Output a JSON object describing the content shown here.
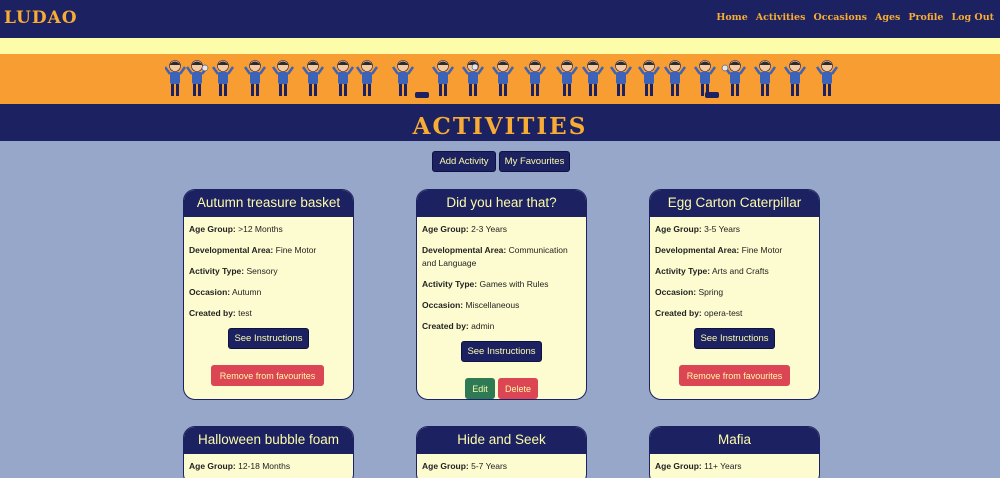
{
  "nav": {
    "brand": "LUDAO",
    "links": [
      "Home",
      "Activities",
      "Occasions",
      "Ages",
      "Profile",
      "Log Out"
    ]
  },
  "page": {
    "title": "ACTIVITIES"
  },
  "actions": {
    "add_activity": "Add Activity",
    "my_favourites": "My Favourites"
  },
  "labels": {
    "age_group": "Age Group:",
    "developmental_area": "Developmental Area:",
    "activity_type": "Activity Type:",
    "occasion": "Occasion:",
    "created_by": "Created by:",
    "see_instructions": "See Instructions",
    "remove_favourites": "Remove from favourites",
    "edit": "Edit",
    "delete": "Delete"
  },
  "cards": [
    {
      "title": "Autumn treasure basket",
      "age_group": ">12 Months",
      "developmental_area": "Fine Motor",
      "activity_type": "Sensory",
      "occasion": "Autumn",
      "created_by": "test"
    },
    {
      "title": "Did you hear that?",
      "age_group": "2-3 Years",
      "developmental_area": "Communication and Language",
      "activity_type": "Games with Rules",
      "occasion": "Miscellaneous",
      "created_by": "admin"
    },
    {
      "title": "Egg Carton Caterpillar",
      "age_group": "3-5 Years",
      "developmental_area": "Fine Motor",
      "activity_type": "Arts and Crafts",
      "occasion": "Spring",
      "created_by": "opera-test"
    },
    {
      "title": "Halloween bubble foam",
      "age_group": "12-18 Months"
    },
    {
      "title": "Hide and Seek",
      "age_group": "5-7 Years"
    },
    {
      "title": "Mafia",
      "age_group": "11+ Years"
    }
  ],
  "colors": {
    "navy": "#1c2161",
    "orange": "#f89d32",
    "cream": "#fdfcd0",
    "yellow_text": "#fdfca8",
    "red": "#dc4554",
    "green": "#2d7a55",
    "page_bg": "#97a7c9"
  }
}
